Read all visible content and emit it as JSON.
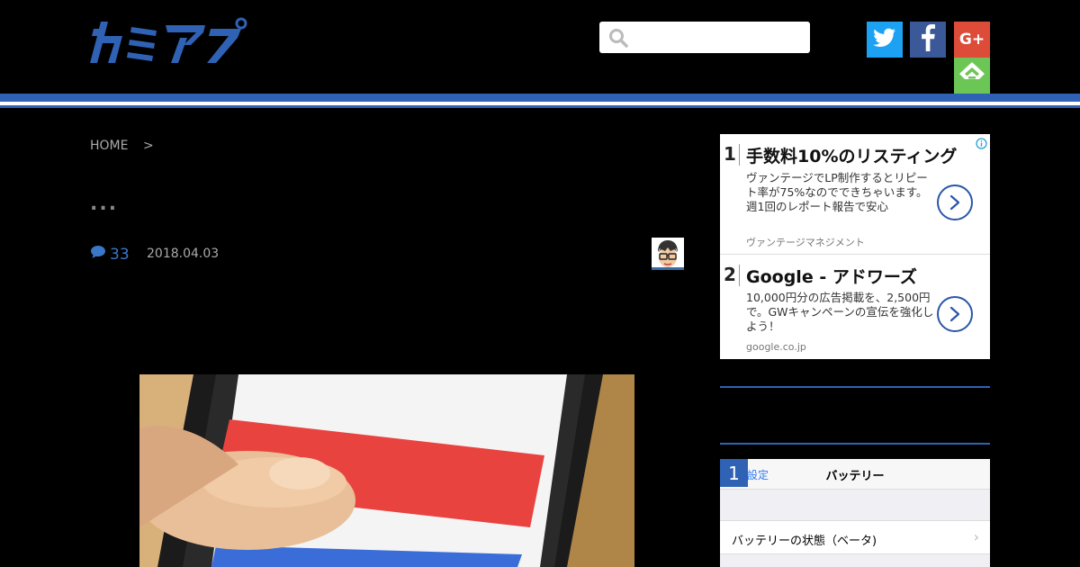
{
  "header": {
    "logo_text": "カミアプ",
    "search_placeholder": "",
    "social": {
      "twitter_icon": "twitter-icon",
      "facebook_icon": "facebook-icon",
      "googleplus_label": "G+",
      "feedly_icon": "feedly-icon"
    }
  },
  "breadcrumb": {
    "home": "HOME",
    "separator": ">"
  },
  "article": {
    "title": "...",
    "comment_count": "33",
    "date": "2018.04.03"
  },
  "ad": {
    "items": [
      {
        "num": "1",
        "headline": "手数料10%のリスティング",
        "description": "ヴァンテージでLP制作するとリピート率が75%なのでできちゃいます。週1回のレポート報告で安心",
        "source": "ヴァンテージマネジメント"
      },
      {
        "num": "2",
        "headline": "Google - アドワーズ",
        "description": "10,000円分の広告掲載を、2,500円で。GWキャンペーンの宣伝を強化しよう！",
        "source": "google.co.jp"
      }
    ]
  },
  "ranking": {
    "title": "",
    "first": {
      "badge": "1",
      "nav_back": "設定",
      "nav_title": "バッテリー",
      "row_label": "バッテリーの状態（ベータ)",
      "row_chevron": "›"
    }
  },
  "colors": {
    "accent": "#2f62b4",
    "background": "#000000",
    "twitter": "#1da1f2",
    "facebook": "#3b5998",
    "googleplus": "#dd4b39",
    "feedly": "#6cc655"
  }
}
